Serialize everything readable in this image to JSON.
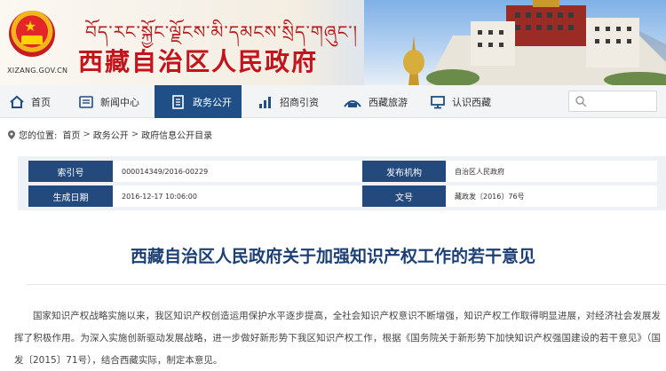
{
  "header": {
    "tibetan_title": "བོད་རང་སྐྱོང་ལྗོངས་མི་དམངས་སྲིད་གཞུང་།",
    "site_title": "西藏自治区人民政府",
    "domain": "XIZANG.GOV.CN",
    "emblem_icon": "national-emblem-icon"
  },
  "nav": {
    "items": [
      {
        "label": "首页",
        "icon": "home-icon"
      },
      {
        "label": "新闻中心",
        "icon": "news-icon"
      },
      {
        "label": "政务公开",
        "icon": "document-icon",
        "active": true
      },
      {
        "label": "招商引资",
        "icon": "bar-chart-icon"
      },
      {
        "label": "西藏旅游",
        "icon": "travel-icon"
      },
      {
        "label": "认识西藏",
        "icon": "monitor-icon"
      }
    ],
    "search_placeholder": ""
  },
  "breadcrumb": {
    "prefix": "您的位置:",
    "items": [
      "首页",
      "政务公开",
      "政府信息公开目录"
    ],
    "separator": ">"
  },
  "info": {
    "index_label": "索引号",
    "index_value": "000014349/2016-00229",
    "issuer_label": "发布机构",
    "issuer_value": "自治区人民政府",
    "date_label": "生成日期",
    "date_value": "2016-12-17 10:06:00",
    "docno_label": "文号",
    "docno_value": "藏政发〔2016〕76号"
  },
  "article": {
    "title": "西藏自治区人民政府关于加强知识产权工作的若干意见",
    "paragraph": "国家知识产权战略实施以来，我区知识产权创造运用保护水平逐步提高，全社会知识产权意识不断增强，知识产权工作取得明显进展，对经济社会发展发挥了积极作用。为深入实施创新驱动发展战略，进一步做好新形势下我区知识产权工作，根据《国务院关于新形势下加快知识产权强国建设的若干意见》（国发〔2015〕71号），结合西藏实际，制定本意见。"
  },
  "colors": {
    "brand_red": "#c3141c",
    "nav_active": "#1f4f86",
    "label_bg": "#23497d",
    "title_blue": "#1c3f74"
  }
}
